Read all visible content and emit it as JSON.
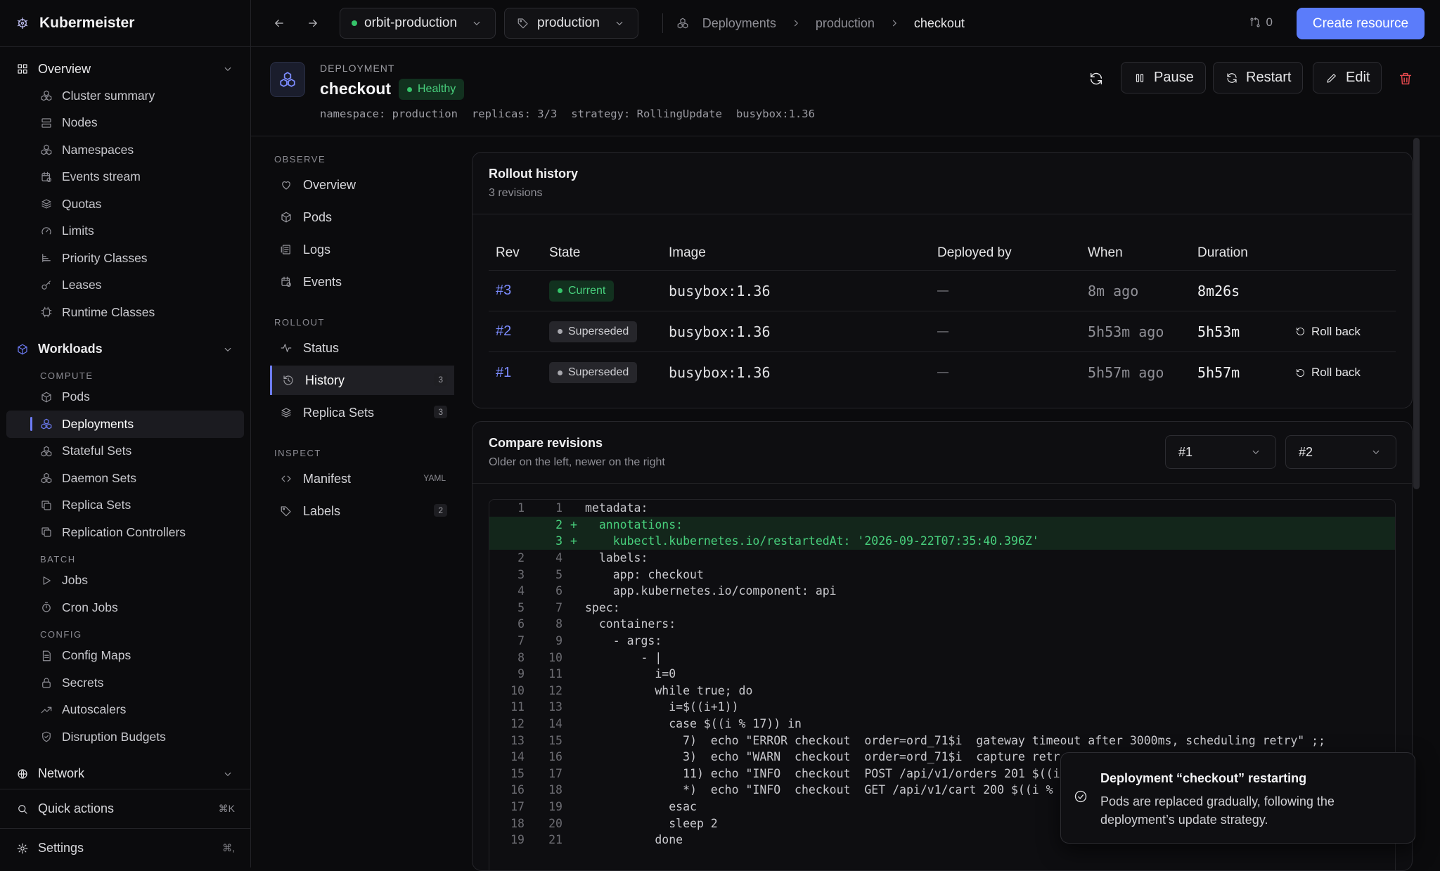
{
  "app": {
    "title": "Kubermeister"
  },
  "sidebar": {
    "overview": {
      "label": "Overview",
      "items": [
        {
          "label": "Cluster summary",
          "icon": "cubes-icon"
        },
        {
          "label": "Nodes",
          "icon": "server-icon"
        },
        {
          "label": "Namespaces",
          "icon": "cubes-icon"
        },
        {
          "label": "Events stream",
          "icon": "calendar-clock-icon"
        },
        {
          "label": "Quotas",
          "icon": "layers-icon"
        },
        {
          "label": "Limits",
          "icon": "gauge-icon"
        },
        {
          "label": "Priority Classes",
          "icon": "priority-icon"
        },
        {
          "label": "Leases",
          "icon": "key-icon"
        },
        {
          "label": "Runtime Classes",
          "icon": "chip-icon"
        }
      ]
    },
    "workloads": {
      "label": "Workloads",
      "sections": [
        {
          "title": "COMPUTE",
          "items": [
            {
              "label": "Pods",
              "icon": "box-icon"
            },
            {
              "label": "Deployments",
              "icon": "cubes-icon"
            },
            {
              "label": "Stateful Sets",
              "icon": "cubes-icon"
            },
            {
              "label": "Daemon Sets",
              "icon": "cubes-icon"
            },
            {
              "label": "Replica Sets",
              "icon": "copy-icon"
            },
            {
              "label": "Replication Controllers",
              "icon": "copy-icon"
            }
          ]
        },
        {
          "title": "BATCH",
          "items": [
            {
              "label": "Jobs",
              "icon": "play-icon"
            },
            {
              "label": "Cron Jobs",
              "icon": "timer-icon"
            }
          ]
        },
        {
          "title": "CONFIG",
          "items": [
            {
              "label": "Config Maps",
              "icon": "file-icon"
            },
            {
              "label": "Secrets",
              "icon": "lock-icon"
            },
            {
              "label": "Autoscalers",
              "icon": "trend-icon"
            },
            {
              "label": "Disruption Budgets",
              "icon": "shield-icon"
            }
          ]
        }
      ]
    },
    "network": {
      "label": "Network"
    },
    "quick_actions": {
      "label": "Quick actions",
      "shortcut": "⌘K"
    },
    "settings": {
      "label": "Settings",
      "shortcut": "⌘,"
    }
  },
  "topbar": {
    "cluster": "orbit-production",
    "namespace": "production",
    "breadcrumbs": [
      "Deployments",
      "production",
      "checkout"
    ],
    "git_count": "0",
    "create_label": "Create resource"
  },
  "deployment": {
    "kind": "DEPLOYMENT",
    "name": "checkout",
    "status": "Healthy",
    "meta": [
      "namespace: production",
      "replicas: 3/3",
      "strategy: RollingUpdate",
      "busybox:1.36"
    ],
    "actions": {
      "pause": "Pause",
      "restart": "Restart",
      "edit": "Edit"
    }
  },
  "subnav": {
    "sections": [
      {
        "title": "OBSERVE",
        "items": [
          {
            "label": "Overview",
            "icon": "heart-icon"
          },
          {
            "label": "Pods",
            "icon": "box-icon"
          },
          {
            "label": "Logs",
            "icon": "logs-icon"
          },
          {
            "label": "Events",
            "icon": "calendar-clock-icon"
          }
        ]
      },
      {
        "title": "ROLLOUT",
        "items": [
          {
            "label": "Status",
            "icon": "activity-icon"
          },
          {
            "label": "History",
            "icon": "history-icon",
            "count": "3"
          },
          {
            "label": "Replica Sets",
            "icon": "layers-icon",
            "count": "3"
          }
        ]
      },
      {
        "title": "INSPECT",
        "items": [
          {
            "label": "Manifest",
            "icon": "code-icon",
            "tag": "YAML"
          },
          {
            "label": "Labels",
            "icon": "tag-icon",
            "count": "2"
          }
        ]
      }
    ]
  },
  "rollout": {
    "title": "Rollout history",
    "subtitle": "3 revisions",
    "columns": [
      "Rev",
      "State",
      "Image",
      "Deployed by",
      "When",
      "Duration"
    ],
    "rows": [
      {
        "rev": "#3",
        "state": "Current",
        "image": "busybox:1.36",
        "by": "—",
        "when": "8m ago",
        "duration": "8m26s",
        "action": ""
      },
      {
        "rev": "#2",
        "state": "Superseded",
        "image": "busybox:1.36",
        "by": "—",
        "when": "5h53m ago",
        "duration": "5h53m",
        "action": "Roll back"
      },
      {
        "rev": "#1",
        "state": "Superseded",
        "image": "busybox:1.36",
        "by": "—",
        "when": "5h57m ago",
        "duration": "5h57m",
        "action": "Roll back"
      }
    ]
  },
  "compare": {
    "title": "Compare revisions",
    "subtitle": "Older on the left, newer on the right",
    "left": "#1",
    "right": "#2",
    "lines": [
      {
        "a": "1",
        "b": "1",
        "s": "",
        "t": "metadata:"
      },
      {
        "a": "",
        "b": "2",
        "s": "+",
        "t": "  annotations:"
      },
      {
        "a": "",
        "b": "3",
        "s": "+",
        "t": "    kubectl.kubernetes.io/restartedAt: '2026-09-22T07:35:40.396Z'"
      },
      {
        "a": "2",
        "b": "4",
        "s": "",
        "t": "  labels:"
      },
      {
        "a": "3",
        "b": "5",
        "s": "",
        "t": "    app: checkout"
      },
      {
        "a": "4",
        "b": "6",
        "s": "",
        "t": "    app.kubernetes.io/component: api"
      },
      {
        "a": "5",
        "b": "7",
        "s": "",
        "t": "spec:"
      },
      {
        "a": "6",
        "b": "8",
        "s": "",
        "t": "  containers:"
      },
      {
        "a": "7",
        "b": "9",
        "s": "",
        "t": "    - args:"
      },
      {
        "a": "8",
        "b": "10",
        "s": "",
        "t": "        - |"
      },
      {
        "a": "9",
        "b": "11",
        "s": "",
        "t": "          i=0"
      },
      {
        "a": "10",
        "b": "12",
        "s": "",
        "t": "          while true; do"
      },
      {
        "a": "11",
        "b": "13",
        "s": "",
        "t": "            i=$((i+1))"
      },
      {
        "a": "12",
        "b": "14",
        "s": "",
        "t": "            case $((i % 17)) in"
      },
      {
        "a": "13",
        "b": "15",
        "s": "",
        "t": "              7)  echo \"ERROR checkout  order=ord_71$i  gateway timeout after 3000ms, scheduling retry\" ;;"
      },
      {
        "a": "14",
        "b": "16",
        "s": "",
        "t": "              3)  echo \"WARN  checkout  order=ord_71$i  capture retr"
      },
      {
        "a": "15",
        "b": "17",
        "s": "",
        "t": "              11) echo \"INFO  checkout  POST /api/v1/orders 201 $((i"
      },
      {
        "a": "16",
        "b": "18",
        "s": "",
        "t": "              *)  echo \"INFO  checkout  GET /api/v1/cart 200 $((i %"
      },
      {
        "a": "17",
        "b": "19",
        "s": "",
        "t": "            esac"
      },
      {
        "a": "18",
        "b": "20",
        "s": "",
        "t": "            sleep 2"
      },
      {
        "a": "19",
        "b": "21",
        "s": "",
        "t": "          done"
      }
    ]
  },
  "toast": {
    "title": "Deployment “checkout” restarting",
    "body": "Pods are replaced gradually, following the deployment’s update strategy."
  },
  "colors": {
    "accent": "#5b7cfa",
    "healthy": "#48d07d",
    "background": "#0b0b0d"
  }
}
